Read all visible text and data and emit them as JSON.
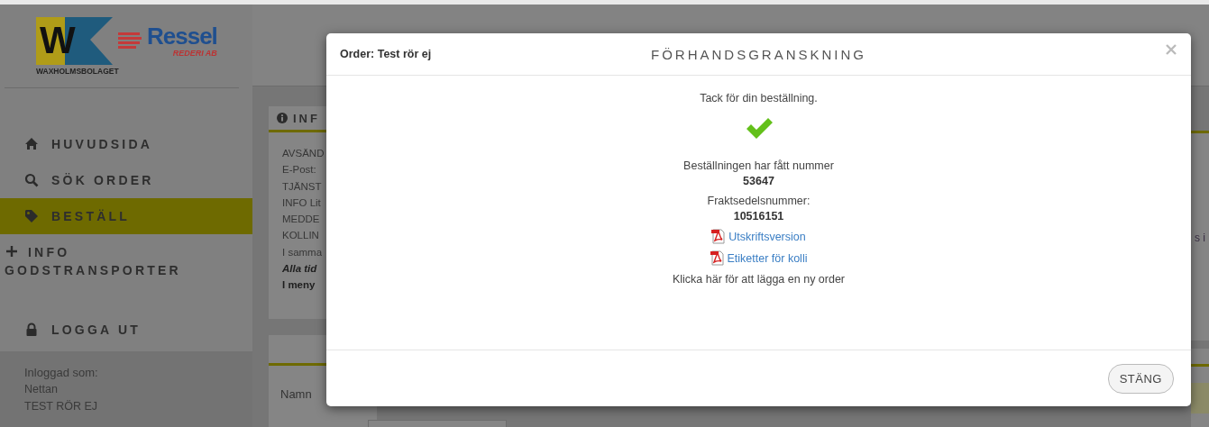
{
  "sidebar": {
    "logo": {
      "mark": "W",
      "name": "Ressel",
      "sub": "REDERI AB",
      "caption": "WAXHOLMSBOLAGET"
    },
    "nav": [
      {
        "label": "HUVUDSIDA",
        "selected": false
      },
      {
        "label": "SÖK ORDER",
        "selected": false
      },
      {
        "label": "BESTÄLL",
        "selected": true
      },
      {
        "label": "INFO GODSTRANSPORTER",
        "selected": false
      },
      {
        "label": "LOGGA UT",
        "selected": false
      }
    ],
    "login": {
      "label": "Inloggad som:",
      "user": "Nettan",
      "company": "TEST RÖR EJ"
    }
  },
  "main": {
    "info_card": {
      "title": "INF",
      "lines": [
        {
          "text": "AVSÄND",
          "kind": "plain"
        },
        {
          "text": "E-Post:",
          "kind": "plain"
        },
        {
          "text": "TJÄNST",
          "kind": "plain"
        },
        {
          "text": "INFO Lit",
          "kind": "plain"
        },
        {
          "text": "MEDDE",
          "kind": "plain"
        },
        {
          "text": "KOLLIN",
          "kind": "plain"
        },
        {
          "text": "I samma",
          "kind": "plain"
        },
        {
          "text": "Alla tid",
          "kind": "emphasis"
        },
        {
          "text": "I meny",
          "kind": "strong"
        }
      ]
    },
    "form_card": {
      "label": "Namn"
    },
    "right_fragment": "s i"
  },
  "modal": {
    "order": "Order: Test rör ej",
    "title": "FÖRHANDSGRANSKNING",
    "thanks": "Tack för din beställning.",
    "order_number_label": "Beställningen har fått nummer",
    "order_number": "53647",
    "waybill_label": "Fraktsedelsnummer:",
    "waybill_number": "10516151",
    "links": [
      "Utskriftsversion",
      "Etiketter för kolli"
    ],
    "new_order": "Klicka här för att lägga en ny order",
    "close_button": "STÄNG"
  }
}
